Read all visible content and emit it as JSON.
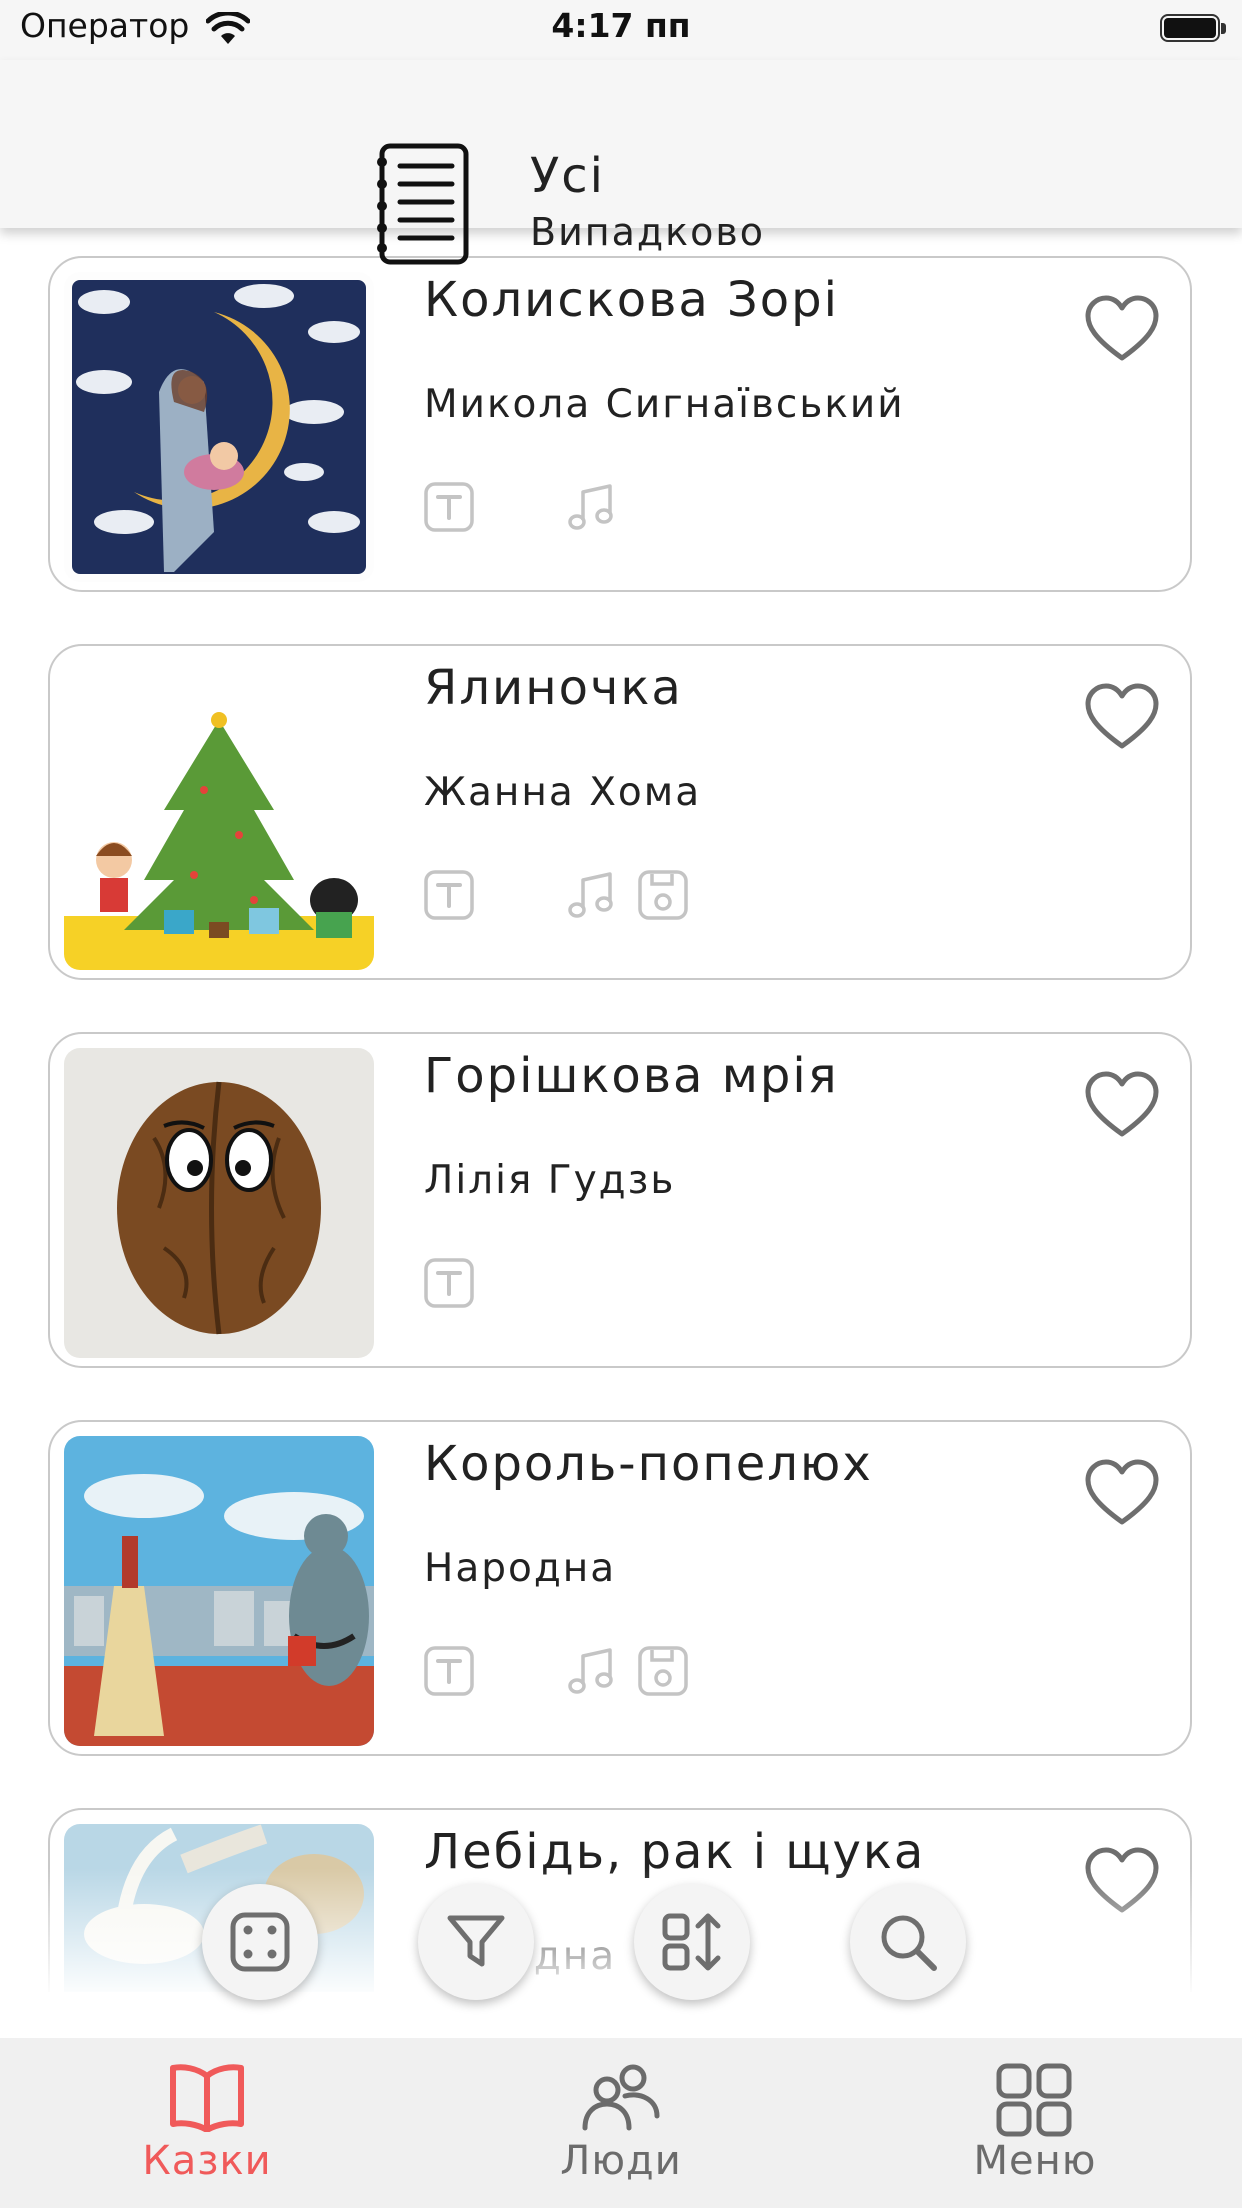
{
  "status_bar": {
    "carrier": "Оператор",
    "time": "4:17 пп",
    "battery_icon": "battery-full-icon",
    "wifi_icon": "wifi-icon"
  },
  "header": {
    "title": "Усі",
    "subtitle": "Випадково",
    "icon": "notebook-list-icon"
  },
  "stories": [
    {
      "title": "Колискова Зорі",
      "author": "Микола Сигнаївський",
      "has_text": true,
      "has_audio": true,
      "has_save": false,
      "favorite": false
    },
    {
      "title": "Ялиночка",
      "author": "Жанна Хома",
      "has_text": true,
      "has_audio": true,
      "has_save": true,
      "favorite": false
    },
    {
      "title": "Горішкова мрія",
      "author": "Лілія Гудзь",
      "has_text": true,
      "has_audio": false,
      "has_save": false,
      "favorite": false
    },
    {
      "title": "Король-попелюх",
      "author": "Народна",
      "has_text": true,
      "has_audio": true,
      "has_save": true,
      "favorite": false
    },
    {
      "title": "Лебідь, рак і щука",
      "author": "Народна",
      "has_text": true,
      "has_audio": false,
      "has_save": false,
      "favorite": false
    }
  ],
  "fab_buttons": [
    "dice-icon",
    "filter-icon",
    "sort-icon",
    "search-icon"
  ],
  "tabs": [
    {
      "label": "Казки",
      "icon": "book-icon",
      "active": true
    },
    {
      "label": "Люди",
      "icon": "people-icon",
      "active": false
    },
    {
      "label": "Меню",
      "icon": "grid-icon",
      "active": false
    }
  ],
  "colors": {
    "accent": "#f05a5a",
    "inactive": "#6b6b6b",
    "icon_gray": "#c4c4c4",
    "card_border": "#c9c9c9"
  }
}
